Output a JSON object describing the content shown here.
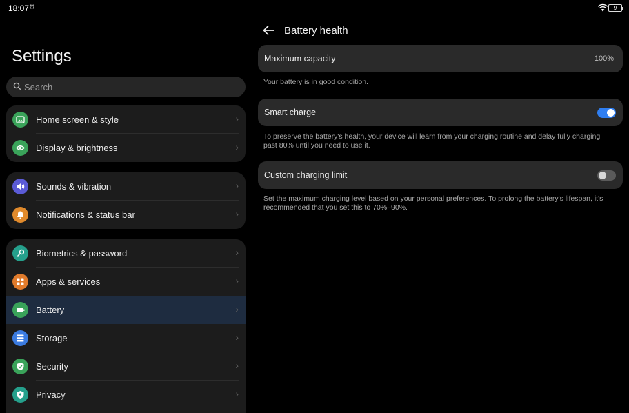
{
  "status_bar": {
    "time": "18:07",
    "battery_level": "9"
  },
  "left": {
    "title": "Settings",
    "search_placeholder": "Search",
    "groups": [
      {
        "items": [
          {
            "label": "Home screen & style",
            "icon": "image-icon",
            "color": "#3aa35a"
          },
          {
            "label": "Display & brightness",
            "icon": "eye-icon",
            "color": "#3aa35a"
          }
        ]
      },
      {
        "items": [
          {
            "label": "Sounds & vibration",
            "icon": "speaker-icon",
            "color": "#5b5bd6"
          },
          {
            "label": "Notifications & status bar",
            "icon": "bell-icon",
            "color": "#e08a2c"
          }
        ]
      },
      {
        "items": [
          {
            "label": "Biometrics & password",
            "icon": "key-icon",
            "color": "#25a08c"
          },
          {
            "label": "Apps & services",
            "icon": "grid-icon",
            "color": "#e07b2c"
          },
          {
            "label": "Battery",
            "icon": "battery-icon",
            "color": "#3aa35a",
            "active": true
          },
          {
            "label": "Storage",
            "icon": "storage-icon",
            "color": "#3b7be0"
          },
          {
            "label": "Security",
            "icon": "shield-check-icon",
            "color": "#3aa35a"
          },
          {
            "label": "Privacy",
            "icon": "shield-icon",
            "color": "#25a08c"
          }
        ]
      }
    ]
  },
  "right": {
    "title": "Battery health",
    "max_capacity": {
      "label": "Maximum capacity",
      "value": "100%",
      "note": "Your battery is in good condition."
    },
    "smart_charge": {
      "label": "Smart charge",
      "enabled": true,
      "note": "To preserve the battery's health, your device will learn from your charging routine and delay fully charging past 80% until you need to use it."
    },
    "custom_limit": {
      "label": "Custom charging limit",
      "enabled": false,
      "note": "Set the maximum charging level based on your personal preferences. To prolong the battery's lifespan, it's recommended that you set this to 70%–90%."
    }
  },
  "colors": {
    "accent": "#2f7ef0",
    "active_row": "#1e2c40"
  }
}
